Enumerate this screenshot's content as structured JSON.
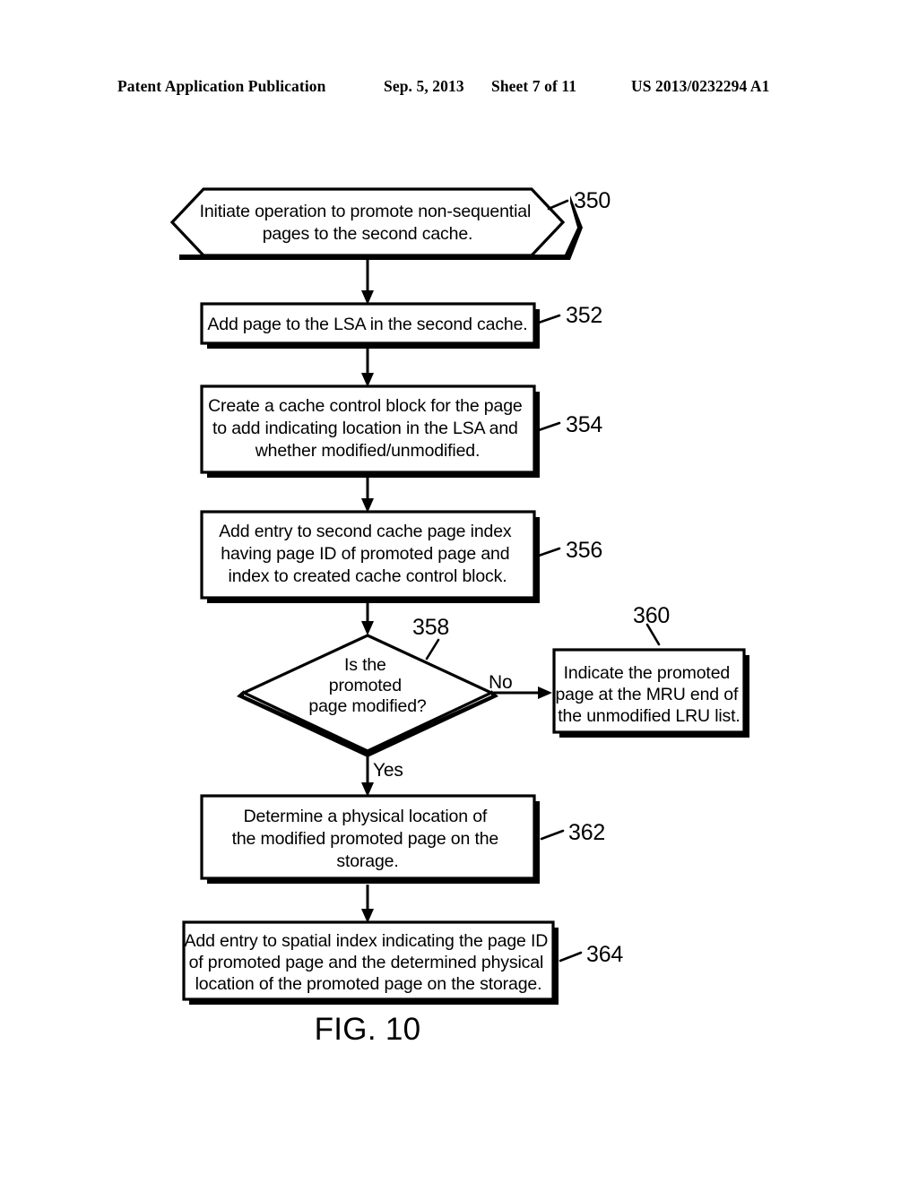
{
  "header": {
    "publication": "Patent Application Publication",
    "date": "Sep. 5, 2013",
    "sheet": "Sheet 7 of 11",
    "patent_number": "US 2013/0232294 A1"
  },
  "figure": {
    "caption": "FIG. 10",
    "nodes": {
      "n350": {
        "ref": "350",
        "shape": "hexagon",
        "lines": [
          "Initiate operation to promote non-sequential",
          "pages to the second cache."
        ]
      },
      "n352": {
        "ref": "352",
        "shape": "rect",
        "lines": [
          "Add page to the LSA in the second cache."
        ]
      },
      "n354": {
        "ref": "354",
        "shape": "rect",
        "lines": [
          "Create a cache control block for the page",
          "to add indicating location in the LSA and",
          "whether modified/unmodified."
        ]
      },
      "n356": {
        "ref": "356",
        "shape": "rect",
        "lines": [
          "Add entry to second cache page index",
          "having page ID of promoted page and",
          "index to created cache control block."
        ]
      },
      "n358": {
        "ref": "358",
        "shape": "diamond",
        "lines": [
          "Is the",
          "promoted",
          "page modified?"
        ]
      },
      "n360": {
        "ref": "360",
        "shape": "rect",
        "lines": [
          "Indicate the promoted",
          "page at the MRU end of",
          "the unmodified LRU list."
        ]
      },
      "n362": {
        "ref": "362",
        "shape": "rect",
        "lines": [
          "Determine a physical location of",
          "the modified promoted page on the",
          "storage."
        ]
      },
      "n364": {
        "ref": "364",
        "shape": "rect",
        "lines": [
          "Add entry to spatial index indicating the page ID",
          "of promoted page and the determined physical",
          "location of the promoted page on the storage."
        ]
      }
    },
    "branches": {
      "no_label": "No",
      "yes_label": "Yes"
    }
  }
}
